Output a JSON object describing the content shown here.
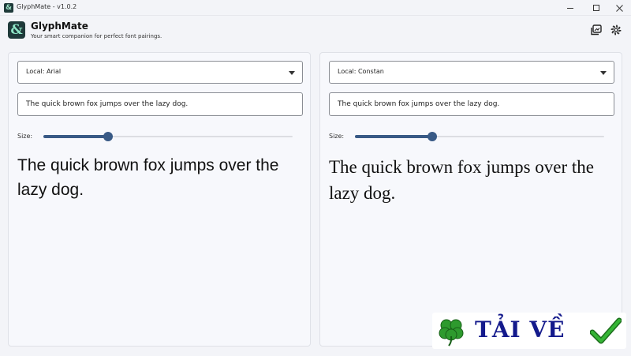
{
  "window": {
    "title": "GlyphMate - v1.0.2",
    "app_icon": "ampersand-icon",
    "controls": [
      "minimize-icon",
      "maximize-icon",
      "close-icon"
    ]
  },
  "header": {
    "app_name": "GlyphMate",
    "tagline": "Your smart companion for perfect font pairings.",
    "logo_glyph": "&",
    "actions": [
      "gallery-icon",
      "gear-icon"
    ]
  },
  "panels": [
    {
      "font_select": "Local: Arial",
      "sample_text": "The quick brown fox jumps over the lazy dog.",
      "size_label": "Size:",
      "size_value": 0.26,
      "preview_text": "The quick brown fox jumps over the lazy dog."
    },
    {
      "font_select": "Local: Constan",
      "sample_text": "The quick brown fox jumps over the lazy dog.",
      "size_label": "Size:",
      "size_value": 0.31,
      "preview_text": "The quick brown fox jumps over the lazy dog."
    }
  ],
  "watermark": {
    "text": "TẢI VỀ",
    "icons": [
      "clover-icon",
      "checkmark-icon"
    ]
  },
  "colors": {
    "accent": "#395a86",
    "logo_bg": "#1f3a3a",
    "logo_fg": "#8fe6c6",
    "watermark_text": "#141a8c",
    "clover": "#2e9a2e",
    "check": "#2fa52f"
  }
}
